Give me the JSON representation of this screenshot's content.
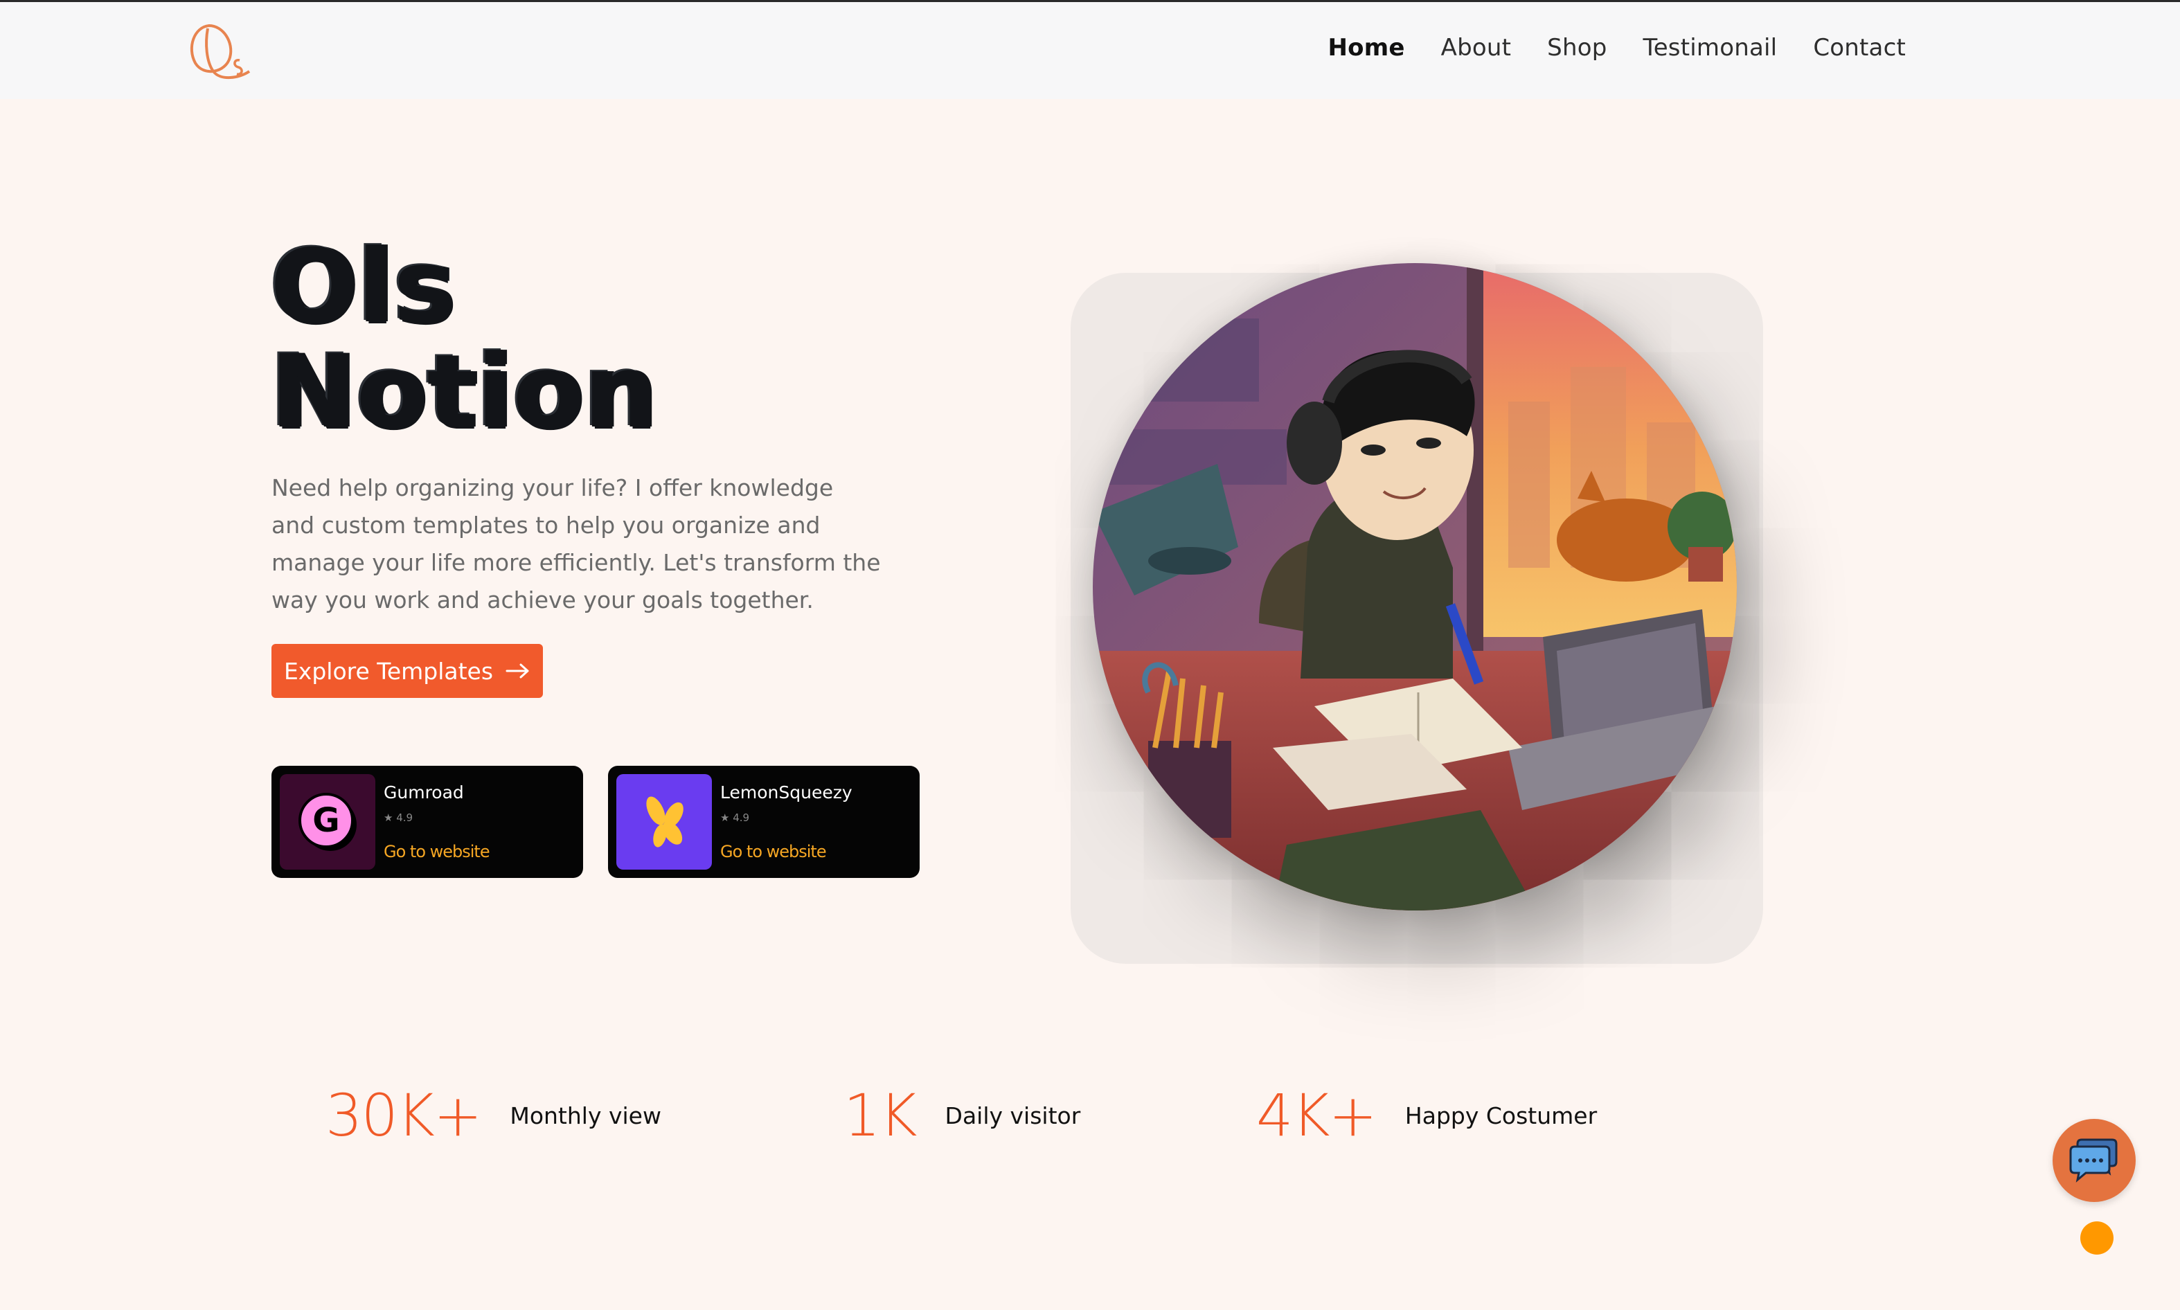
{
  "brand": {
    "logo_text": "Qs"
  },
  "nav": {
    "items": [
      {
        "label": "Home"
      },
      {
        "label": "About"
      },
      {
        "label": "Shop"
      },
      {
        "label": "Testimonail"
      },
      {
        "label": "Contact"
      }
    ],
    "active": "Home"
  },
  "hero": {
    "title_line1": "Ols",
    "title_line2": "Notion",
    "description": "Need help organizing your life? I offer knowledge and custom templates to help you organize and manage your life more efficiently. Let's transform the way you work and achieve your goals together.",
    "cta_label": "Explore Templates"
  },
  "stores": [
    {
      "name": "Gumroad",
      "rating": "4.9",
      "link_label": "Go to website",
      "icon": "gumroad-logo-icon"
    },
    {
      "name": "LemonSqueezy",
      "rating": "4.9",
      "link_label": "Go to website",
      "icon": "lemonsqueezy-logo-icon"
    }
  ],
  "stats": [
    {
      "value": "30K+",
      "label": "Monthly view"
    },
    {
      "value": "1K",
      "label": "Daily visitor"
    },
    {
      "value": "4K+",
      "label": "Happy Costumer"
    }
  ],
  "colors": {
    "accent": "#f15a2c",
    "background": "#fdf5f1",
    "navbar": "#f7f7f8",
    "link": "#f5a623"
  },
  "icons": {
    "chat": "chat-bubbles-icon",
    "arrow": "arrow-right-icon"
  }
}
